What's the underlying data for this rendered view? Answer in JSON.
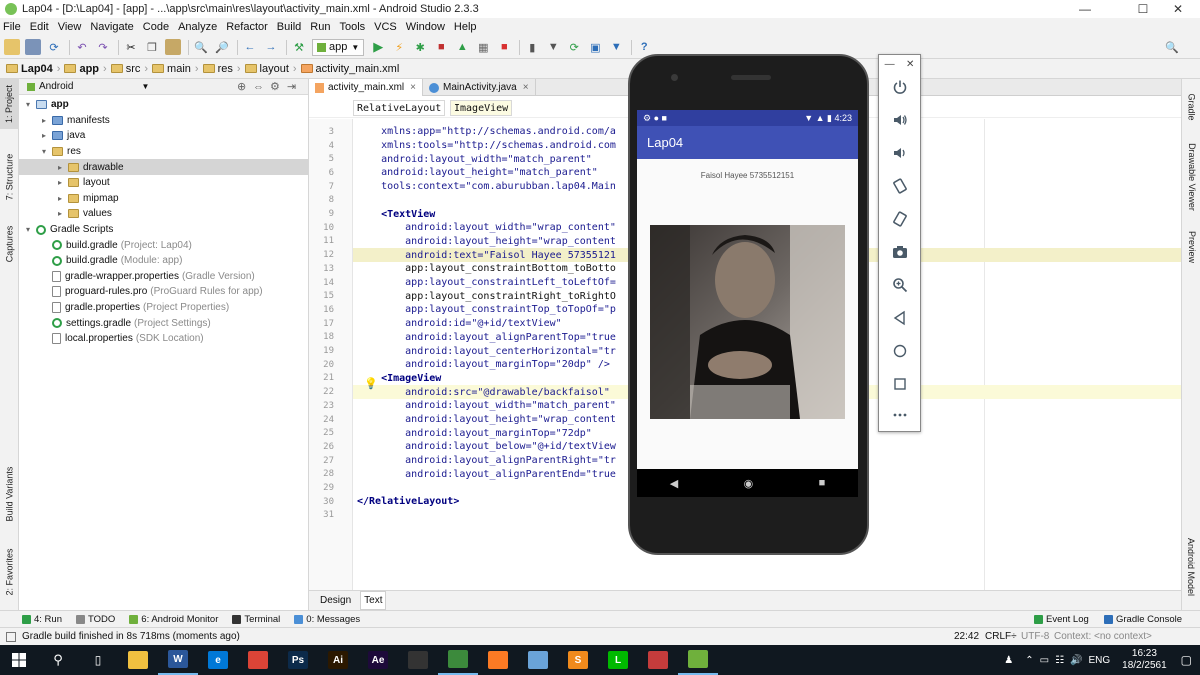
{
  "window": {
    "title": "Lap04 - [D:\\Lap04] - [app] - ...\\app\\src\\main\\res\\layout\\activity_main.xml - Android Studio 2.3.3"
  },
  "menu": [
    "File",
    "Edit",
    "View",
    "Navigate",
    "Code",
    "Analyze",
    "Refactor",
    "Build",
    "Run",
    "Tools",
    "VCS",
    "Window",
    "Help"
  ],
  "toolbar": {
    "run_config": "app"
  },
  "breadcrumb": [
    "Lap04",
    "app",
    "src",
    "main",
    "res",
    "layout",
    "activity_main.xml"
  ],
  "left_tabs": [
    "1: Project",
    "7: Structure",
    "Captures",
    "Build Variants",
    "2: Favorites"
  ],
  "right_tabs": [
    "Gradle",
    "Drawable Viewer",
    "Preview",
    "Android Model"
  ],
  "project": {
    "view_mode": "Android",
    "tree": [
      {
        "label": "app",
        "extra": "",
        "indent": 0,
        "arrow": "▾",
        "icon": "mod",
        "bold": true
      },
      {
        "label": "manifests",
        "extra": "",
        "indent": 1,
        "arrow": "▸",
        "icon": "blue"
      },
      {
        "label": "java",
        "extra": "",
        "indent": 1,
        "arrow": "▸",
        "icon": "blue"
      },
      {
        "label": "res",
        "extra": "",
        "indent": 1,
        "arrow": "▾",
        "icon": "fold"
      },
      {
        "label": "drawable",
        "extra": "",
        "indent": 2,
        "arrow": "▸",
        "icon": "fold",
        "selected": true
      },
      {
        "label": "layout",
        "extra": "",
        "indent": 2,
        "arrow": "▸",
        "icon": "fold"
      },
      {
        "label": "mipmap",
        "extra": "",
        "indent": 2,
        "arrow": "▸",
        "icon": "fold"
      },
      {
        "label": "values",
        "extra": "",
        "indent": 2,
        "arrow": "▸",
        "icon": "fold"
      },
      {
        "label": "Gradle Scripts",
        "extra": "",
        "indent": 0,
        "arrow": "▾",
        "icon": "grad"
      },
      {
        "label": "build.gradle",
        "extra": "(Project: Lap04)",
        "indent": 1,
        "arrow": "",
        "icon": "grad"
      },
      {
        "label": "build.gradle",
        "extra": "(Module: app)",
        "indent": 1,
        "arrow": "",
        "icon": "grad"
      },
      {
        "label": "gradle-wrapper.properties",
        "extra": "(Gradle Version)",
        "indent": 1,
        "arrow": "",
        "icon": "file"
      },
      {
        "label": "proguard-rules.pro",
        "extra": "(ProGuard Rules for app)",
        "indent": 1,
        "arrow": "",
        "icon": "file"
      },
      {
        "label": "gradle.properties",
        "extra": "(Project Properties)",
        "indent": 1,
        "arrow": "",
        "icon": "file"
      },
      {
        "label": "settings.gradle",
        "extra": "(Project Settings)",
        "indent": 1,
        "arrow": "",
        "icon": "grad"
      },
      {
        "label": "local.properties",
        "extra": "(SDK Location)",
        "indent": 1,
        "arrow": "",
        "icon": "file"
      }
    ]
  },
  "editor": {
    "tabs": [
      {
        "label": "activity_main.xml",
        "active": true
      },
      {
        "label": "MainActivity.java",
        "active": false
      }
    ],
    "xml_crumbs": [
      "RelativeLayout",
      "ImageView"
    ],
    "lines": [
      {
        "n": "3",
        "text": "    xmlns:app=\"http://schemas.android.com/a"
      },
      {
        "n": "4",
        "text": "    xmlns:tools=\"http://schemas.android.com"
      },
      {
        "n": "5",
        "text": "    android:layout_width=\"match_parent\""
      },
      {
        "n": "6",
        "text": "    android:layout_height=\"match_parent\""
      },
      {
        "n": "7",
        "text": "    tools:context=\"com.aburubban.lap04.Main"
      },
      {
        "n": "8",
        "text": ""
      },
      {
        "n": "9",
        "text": "    <TextView"
      },
      {
        "n": "10",
        "text": "        android:layout_width=\"wrap_content\""
      },
      {
        "n": "11",
        "text": "        android:layout_height=\"wrap_content"
      },
      {
        "n": "12",
        "text": "        android:text=\"Faisol Hayee 57355121"
      },
      {
        "n": "13",
        "text": "        app:layout_constraintBottom_toBotto"
      },
      {
        "n": "14",
        "text": "        app:layout_constraintLeft_toLeftOf="
      },
      {
        "n": "15",
        "text": "        app:layout_constraintRight_toRightO"
      },
      {
        "n": "16",
        "text": "        app:layout_constraintTop_toTopOf=\"p"
      },
      {
        "n": "17",
        "text": "        android:id=\"@+id/textView\""
      },
      {
        "n": "18",
        "text": "        android:layout_alignParentTop=\"true"
      },
      {
        "n": "19",
        "text": "        android:layout_centerHorizontal=\"tr"
      },
      {
        "n": "20",
        "text": "        android:layout_marginTop=\"20dp\" />"
      },
      {
        "n": "21",
        "text": "    <ImageView"
      },
      {
        "n": "22",
        "text": "        android:src=\"@drawable/backfaisol\""
      },
      {
        "n": "23",
        "text": "        android:layout_width=\"match_parent\""
      },
      {
        "n": "24",
        "text": "        android:layout_height=\"wrap_content"
      },
      {
        "n": "25",
        "text": "        android:layout_marginTop=\"72dp\""
      },
      {
        "n": "26",
        "text": "        android:layout_below=\"@+id/textView"
      },
      {
        "n": "27",
        "text": "        android:layout_alignParentRight=\"tr"
      },
      {
        "n": "28",
        "text": "        android:layout_alignParentEnd=\"true"
      },
      {
        "n": "29",
        "text": ""
      },
      {
        "n": "30",
        "text": "</RelativeLayout>"
      },
      {
        "n": "31",
        "text": ""
      }
    ],
    "bottom_tabs": [
      {
        "label": "Design",
        "active": false
      },
      {
        "label": "Text",
        "active": true
      }
    ]
  },
  "emulator": {
    "status_time": "4:23",
    "app_title": "Lap04",
    "text_view": "Faisol Hayee 5735512151",
    "side_buttons": [
      "power-icon",
      "volume-up-icon",
      "volume-down-icon",
      "rotate-left-icon",
      "rotate-right-icon",
      "camera-icon",
      "zoom-icon",
      "back-icon",
      "home-icon",
      "overview-icon",
      "more-icon"
    ]
  },
  "tool_windows": {
    "left": [
      "4: Run",
      "TODO",
      "6: Android Monitor",
      "Terminal",
      "0: Messages"
    ],
    "right": [
      "Event Log",
      "Gradle Console"
    ]
  },
  "status": {
    "message": "Gradle build finished in 8s 718ms (moments ago)",
    "position": "22:42",
    "line_sep": "CRLF÷",
    "encoding": "UTF-8",
    "context": "Context: <no context>"
  },
  "taskbar": {
    "apps": [
      {
        "name": "file-explorer-icon",
        "color": "#f0c040",
        "glyph": ""
      },
      {
        "name": "word-icon",
        "color": "#2b579a",
        "glyph": "W"
      },
      {
        "name": "edge-icon",
        "color": "#0078d7",
        "glyph": "e"
      },
      {
        "name": "chrome-icon",
        "color": "#db4437",
        "glyph": ""
      },
      {
        "name": "photoshop-icon",
        "color": "#0c2a4a",
        "glyph": "Ps"
      },
      {
        "name": "illustrator-icon",
        "color": "#2b1800",
        "glyph": "Ai"
      },
      {
        "name": "after-effects-icon",
        "color": "#1d0a3a",
        "glyph": "Ae"
      },
      {
        "name": "media-icon",
        "color": "#333333",
        "glyph": ""
      },
      {
        "name": "android-studio-icon",
        "color": "#3c8a3c",
        "glyph": ""
      },
      {
        "name": "xampp-icon",
        "color": "#fb7a24",
        "glyph": ""
      },
      {
        "name": "virtualbox-icon",
        "color": "#6aa3d8",
        "glyph": ""
      },
      {
        "name": "sublime-icon",
        "color": "#f08a1c",
        "glyph": "S"
      },
      {
        "name": "line-icon",
        "color": "#00b900",
        "glyph": "L"
      },
      {
        "name": "paint-icon",
        "color": "#c43c3c",
        "glyph": ""
      },
      {
        "name": "emulator-icon",
        "color": "#6fb03c",
        "glyph": ""
      }
    ],
    "lang": "ENG",
    "time": "16:23",
    "date": "18/2/2561"
  }
}
